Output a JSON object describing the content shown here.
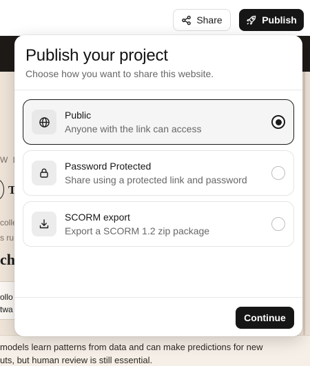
{
  "header": {
    "share_label": "Share",
    "share_icon": "share-icon",
    "publish_label": "Publish",
    "publish_icon": "rocket-icon"
  },
  "modal": {
    "title": "Publish your project",
    "subtitle": "Choose how you want to share this website.",
    "options": [
      {
        "title": "Public",
        "description": "Anyone with the link can access",
        "icon": "globe-icon",
        "selected": true
      },
      {
        "title": "Password Protected",
        "description": "Share using a protected link and password",
        "icon": "lock-icon",
        "selected": false
      },
      {
        "title": "SCORM export",
        "description": "Export a SCORM 1.2 zip package",
        "icon": "download-icon",
        "selected": false
      }
    ],
    "continue_label": "Continue"
  },
  "background": {
    "fragments": [
      "W L",
      "T",
      "colle",
      "s ru",
      "ch",
      "ollo",
      "twa"
    ],
    "bottom_lines": [
      "models learn patterns from data and can make predictions for new",
      "uts, but human review is still essential."
    ]
  },
  "colors": {
    "accent": "#161616",
    "page_background": "#efe4d8",
    "dark_bar": "#1e1a17"
  }
}
